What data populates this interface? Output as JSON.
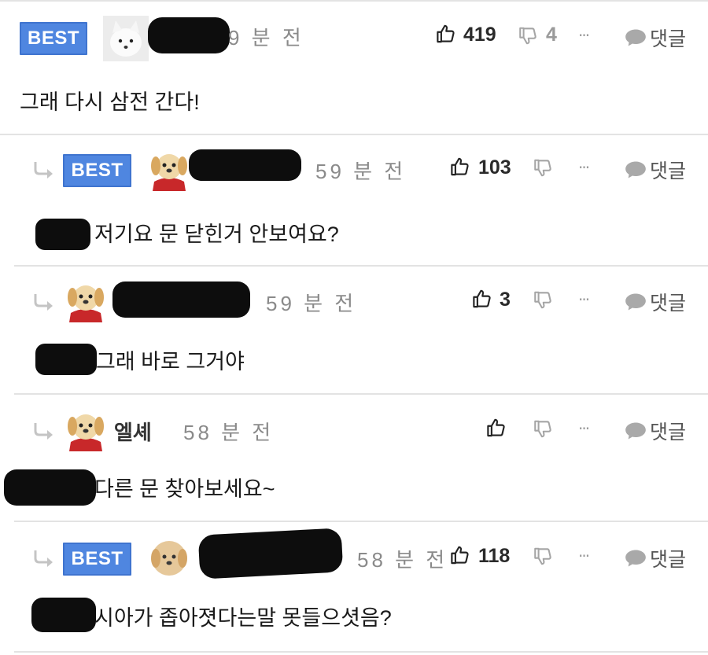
{
  "best_label": "BEST",
  "reply_label": "댓글",
  "more_label": "···",
  "comments": [
    {
      "best": true,
      "time": "59 분 전",
      "time_visible": "9 분 전",
      "upvotes": "419",
      "downvotes": "4",
      "text": "그래 다시 삼전 간다!"
    },
    {
      "best": true,
      "time": "59 분 전",
      "upvotes": "103",
      "downvotes": "",
      "text": "저기요 문 닫힌거 안보여요?"
    },
    {
      "best": false,
      "time": "59 분 전",
      "upvotes": "3",
      "downvotes": "",
      "text": "그래 바로 그거야"
    },
    {
      "best": false,
      "nickname": "엘셰",
      "time": "58 분 전",
      "upvotes": "",
      "downvotes": "",
      "text": "다른 문 찾아보세요~"
    },
    {
      "best": true,
      "time": "58 분 전",
      "upvotes": "118",
      "downvotes": "",
      "text": "시아가 좁아졋다는말 못들으셧음?"
    }
  ]
}
